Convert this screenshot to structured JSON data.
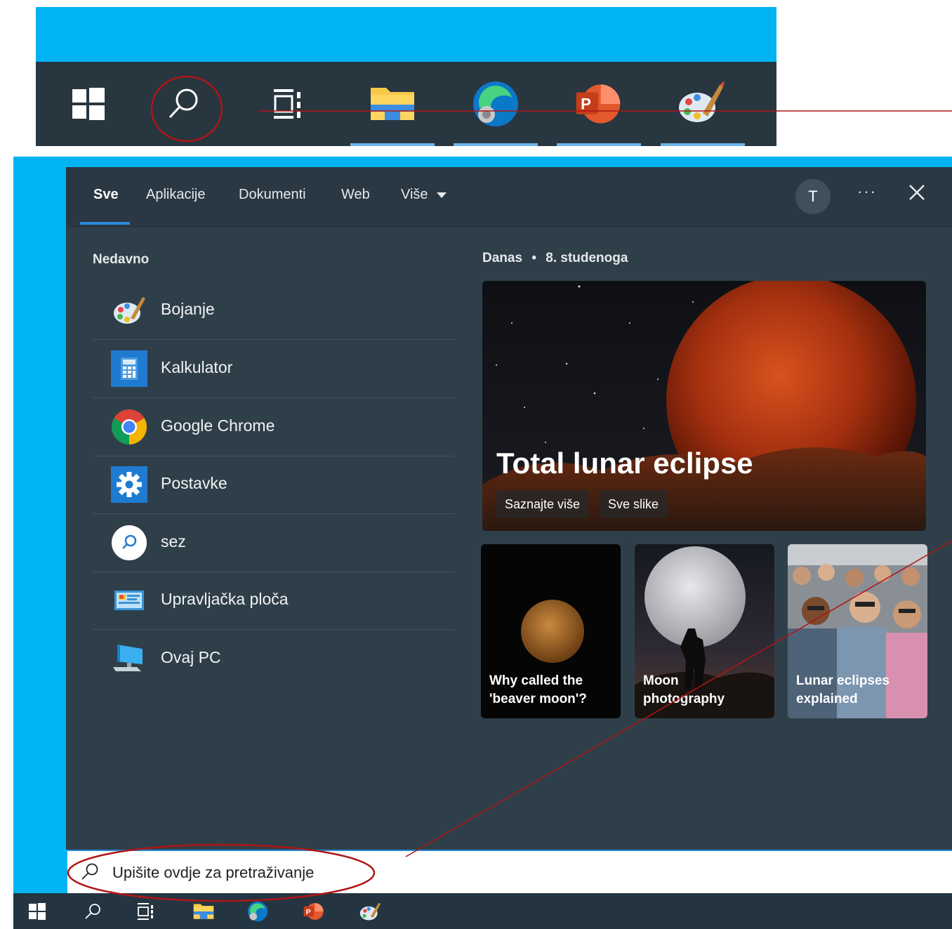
{
  "tabs": [
    {
      "label": "Sve",
      "active": true
    },
    {
      "label": "Aplikacije"
    },
    {
      "label": "Dokumenti"
    },
    {
      "label": "Web"
    },
    {
      "label": "Više"
    }
  ],
  "account": {
    "initial": "T"
  },
  "more_label": "···",
  "recent": {
    "title": "Nedavno",
    "items": [
      {
        "label": "Bojanje",
        "icon": "paint-icon"
      },
      {
        "label": "Kalkulator",
        "icon": "calculator-icon"
      },
      {
        "label": "Google Chrome",
        "icon": "chrome-icon"
      },
      {
        "label": "Postavke",
        "icon": "settings-icon"
      },
      {
        "label": "sez",
        "icon": "search-app-icon"
      },
      {
        "label": "Upravljačka ploča",
        "icon": "control-panel-icon"
      },
      {
        "label": "Ovaj PC",
        "icon": "this-pc-icon"
      }
    ]
  },
  "today": {
    "label": "Danas",
    "date": "8. studenoga"
  },
  "hero": {
    "title": "Total lunar eclipse",
    "learn_more": "Saznajte više",
    "all_images": "Sve slike"
  },
  "cards": [
    {
      "title": "Why called the\n'beaver moon'?"
    },
    {
      "title": "Moon\nphotography"
    },
    {
      "title": "Lunar eclipses\nexplained"
    }
  ],
  "search": {
    "placeholder": "Upišite ovdje za pretraživanje"
  },
  "colors": {
    "desktop": "#00b4f4",
    "taskbar": "#283640",
    "flyout": "#2f3f4a",
    "accent": "#2b88d8",
    "annotation": "#b01515"
  }
}
